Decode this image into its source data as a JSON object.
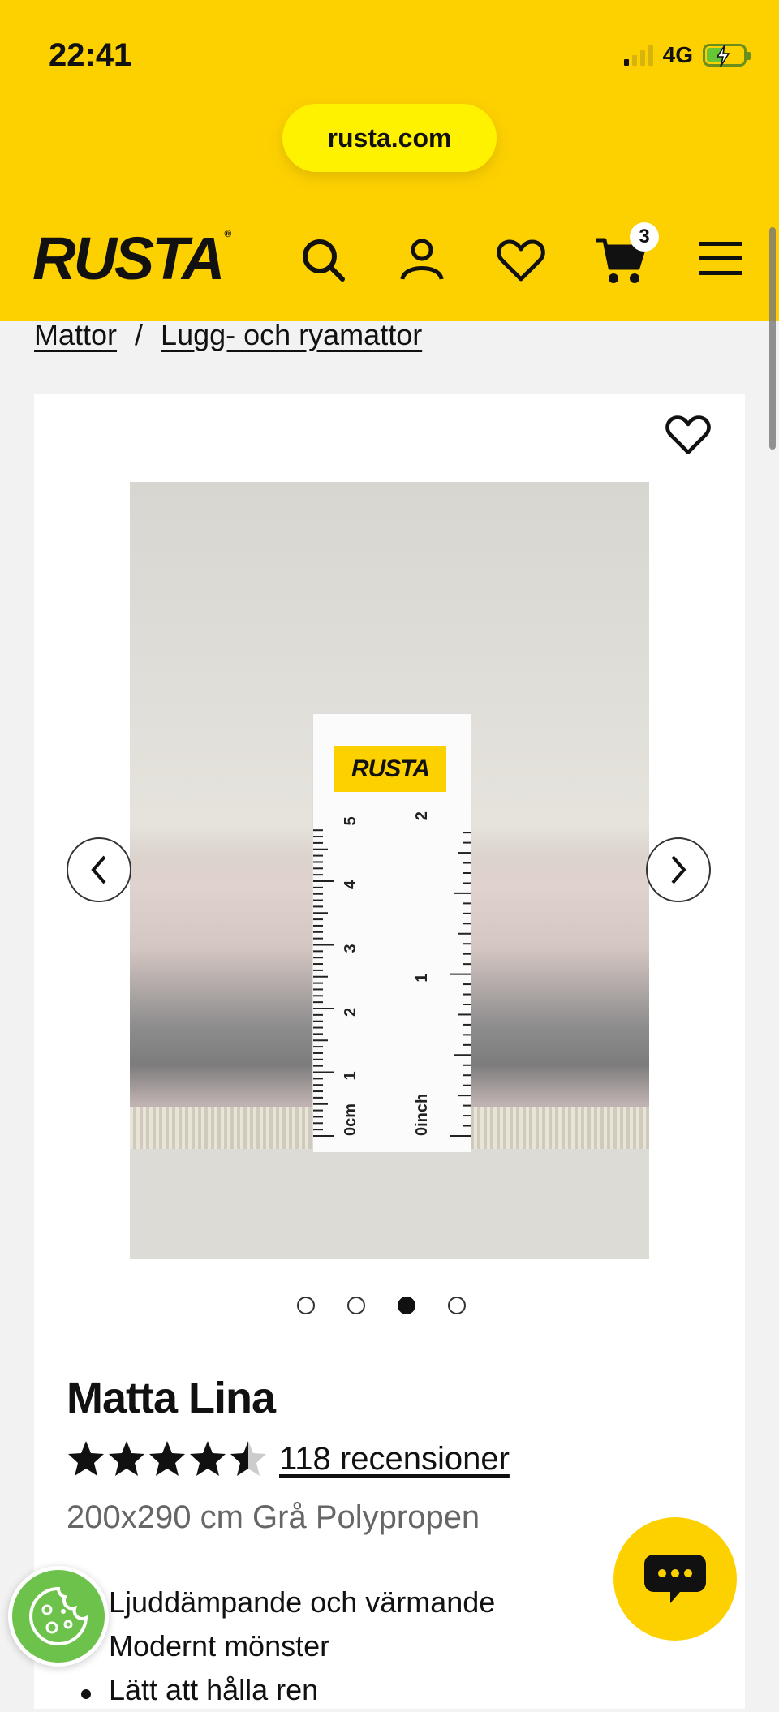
{
  "status_bar": {
    "time": "22:41",
    "network": "4G",
    "battery_level": 0.46
  },
  "browser": {
    "url": "rusta.com"
  },
  "header": {
    "logo_text": "RUSTA",
    "cart_count": "3",
    "brand_color": "#fdd100",
    "icons": [
      "search-icon",
      "account-icon",
      "heart-icon",
      "cart-icon",
      "menu-icon"
    ]
  },
  "breadcrumb": {
    "items": [
      "Mattor",
      "Lugg- och ryamattor"
    ],
    "separator": "/"
  },
  "gallery": {
    "ruler_logo": "RUSTA",
    "ruler_cm_labels": [
      "0cm",
      "1",
      "2",
      "3",
      "4",
      "5"
    ],
    "ruler_inch_labels": [
      "0inch",
      "1",
      "2"
    ],
    "image_count": 4,
    "active_image": 3
  },
  "product": {
    "title": "Matta Lina",
    "rating": 4.5,
    "reviews_label": "118 recensioner",
    "subtitle": "200x290 cm Grå Polypropen",
    "bullets": [
      "Ljuddämpande och värmande",
      "Modernt mönster",
      "Lätt att hålla ren"
    ]
  }
}
